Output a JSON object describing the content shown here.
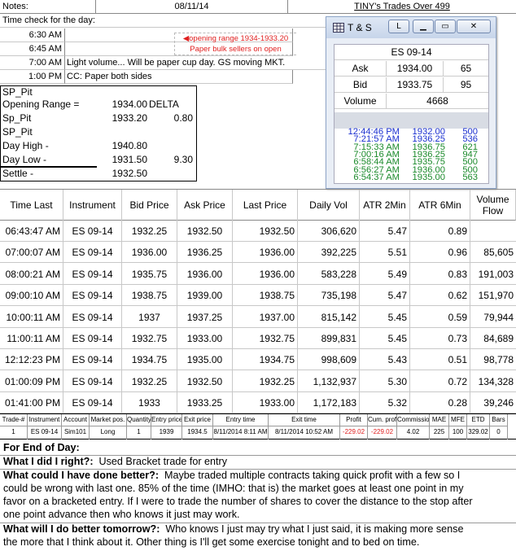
{
  "header": {
    "notes_label": "Notes:",
    "date": "08/11/14",
    "title": "TINY's Trades Over 499"
  },
  "time_check": {
    "label": "Time check for the day:",
    "rows": [
      {
        "time": "6:30 AM",
        "note": ""
      },
      {
        "time": "6:45 AM",
        "note": ""
      },
      {
        "time": "7:00 AM",
        "note": "Light volume... Will be paper cup day. GS moving MKT."
      },
      {
        "time": "1:00 PM",
        "note": "CC: Paper both sides"
      }
    ],
    "red_annotation": [
      "opening range 1934-1933.20",
      "Paper bulk sellers on open"
    ],
    "red_color": "#e02020"
  },
  "pit": {
    "rows": [
      {
        "label": "SP_Pit",
        "value": "",
        "extra": ""
      },
      {
        "label": "Opening Range =",
        "value": "1934.00",
        "extra": "DELTA"
      },
      {
        "label": "Sp_Pit",
        "value": "1933.20",
        "extra": "0.80"
      },
      {
        "label": "SP_Pit",
        "value": "",
        "extra": ""
      },
      {
        "label": "Day High -",
        "value": "1940.80",
        "extra": ""
      },
      {
        "label": "Day Low -",
        "value": "1931.50",
        "extra": "9.30"
      },
      {
        "label": "Settle -",
        "value": "1932.50",
        "extra": ""
      }
    ]
  },
  "ts_window": {
    "title": "T & S",
    "lock_label": "L",
    "symbol": "ES 09-14",
    "quote": [
      {
        "label": "Ask",
        "price": "1934.00",
        "size": "65"
      },
      {
        "label": "Bid",
        "price": "1933.75",
        "size": "95"
      }
    ],
    "volume_label": "Volume",
    "volume": "4668",
    "prints": [
      {
        "time": "12:44:46 PM",
        "price": "1932.00",
        "size": "500",
        "color": "#1a2fd0"
      },
      {
        "time": "7:21:57 AM",
        "price": "1936.25",
        "size": "536",
        "color": "#1a2fd0"
      },
      {
        "time": "7:15:33 AM",
        "price": "1936.75",
        "size": "621",
        "color": "#1a8a2a"
      },
      {
        "time": "7:00:16 AM",
        "price": "1936.25",
        "size": "947",
        "color": "#1a8a2a"
      },
      {
        "time": "6:58:44 AM",
        "price": "1935.75",
        "size": "500",
        "color": "#1a8a2a"
      },
      {
        "time": "6:56:27 AM",
        "price": "1936.00",
        "size": "500",
        "color": "#1a8a2a"
      },
      {
        "time": "6:54:37 AM",
        "price": "1935.00",
        "size": "563",
        "color": "#1a8a2a"
      }
    ]
  },
  "main_table": {
    "columns": [
      "Time Last",
      "Instrument",
      "Bid Price",
      "Ask Price",
      "Last Price",
      "Daily Vol",
      "ATR 2Min",
      "ATR 6Min",
      "Volume Flow"
    ],
    "rows": [
      [
        "06:43:47 AM",
        "ES 09-14",
        "1932.25",
        "1932.50",
        "1932.50",
        "306,620",
        "5.47",
        "0.89",
        ""
      ],
      [
        "07:00:07 AM",
        "ES 09-14",
        "1936.00",
        "1936.25",
        "1936.00",
        "392,225",
        "5.51",
        "0.96",
        "85,605"
      ],
      [
        "08:00:21 AM",
        "ES 09-14",
        "1935.75",
        "1936.00",
        "1936.00",
        "583,228",
        "5.49",
        "0.83",
        "191,003"
      ],
      [
        "09:00:10 AM",
        "ES 09-14",
        "1938.75",
        "1939.00",
        "1938.75",
        "735,198",
        "5.47",
        "0.62",
        "151,970"
      ],
      [
        "10:00:11 AM",
        "ES 09-14",
        "1937",
        "1937.25",
        "1937.00",
        "815,142",
        "5.45",
        "0.59",
        "79,944"
      ],
      [
        "11:00:11 AM",
        "ES 09-14",
        "1932.75",
        "1933.00",
        "1932.75",
        "899,831",
        "5.45",
        "0.73",
        "84,689"
      ],
      [
        "12:12:23 PM",
        "ES 09-14",
        "1934.75",
        "1935.00",
        "1934.75",
        "998,609",
        "5.43",
        "0.51",
        "98,778"
      ],
      [
        "01:00:09 PM",
        "ES 09-14",
        "1932.25",
        "1932.50",
        "1932.25",
        "1,132,937",
        "5.30",
        "0.72",
        "134,328"
      ],
      [
        "01:41:00 PM",
        "ES 09-14",
        "1933",
        "1933.25",
        "1933.00",
        "1,172,183",
        "5.32",
        "0.28",
        "39,246"
      ]
    ]
  },
  "trade_table": {
    "columns": [
      "Trade-#",
      "Instrument",
      "Account",
      "Market pos.",
      "Quantity",
      "Entry price",
      "Exit price",
      "Entry time",
      "Exit time",
      "Profit",
      "Cum. profit",
      "Commission",
      "MAE",
      "MFE",
      "ETD",
      "Bars"
    ],
    "row": [
      "1",
      "ES 09-14",
      "Sim101",
      "Long",
      "1",
      "1939",
      "1934.5",
      "8/11/2014 8:11 AM",
      "8/11/2014 10:52 AM",
      "-229.02",
      "-229.02",
      "4.02",
      "225",
      "100",
      "329.02",
      "0"
    ],
    "loss_color": "#e02020"
  },
  "notes": {
    "end_of_day": "For End of Day:",
    "did_right_q": "What I did I right?:",
    "did_right_a": "Used Bracket trade for entry",
    "better_q": "What could I have done better?:",
    "better_a_1": "Maybe traded multiple contracts taking quick profit with a few so I",
    "better_a_2": "could be wrong with last one.  85% of the time (IMHO: that is) the market goes at least one point in my",
    "better_a_3": "favor on a bracketed entry.  If I were to trade the number of shares to cover the distance to the stop after",
    "better_a_4": "one point advance then who knows it just may work.",
    "tomorrow_q": "What will I do better tomorrow?:",
    "tomorrow_a_1": "Who knows I just may try what I just said, it is making more sense",
    "tomorrow_a_2": "the more that I think about it.  Other thing is I'll get some exercise tonight and to bed on time."
  }
}
